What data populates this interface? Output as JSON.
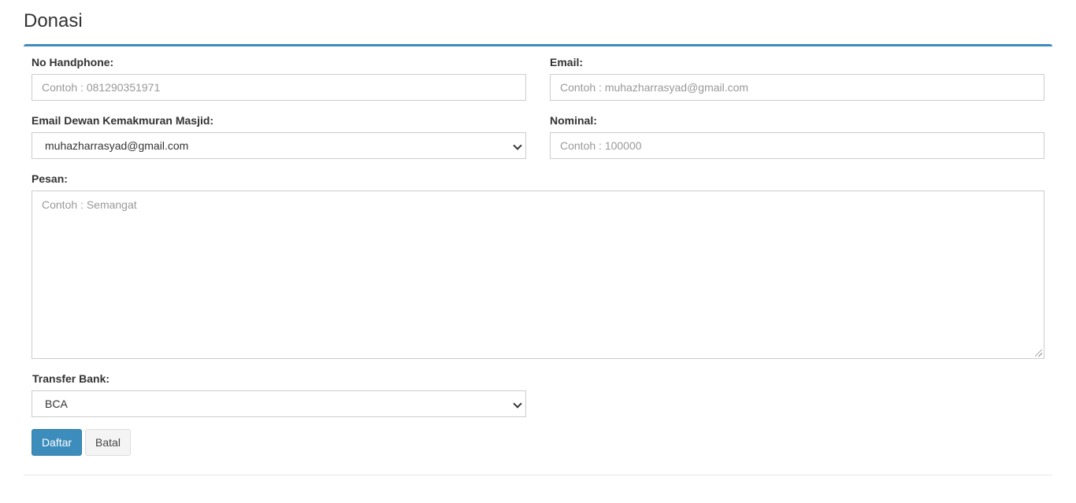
{
  "page": {
    "title": "Donasi"
  },
  "form": {
    "phone": {
      "label": "No Handphone:",
      "placeholder": "Contoh : 081290351971"
    },
    "email": {
      "label": "Email:",
      "placeholder": "Contoh : muhazharrasyad@gmail.com"
    },
    "dkm_email": {
      "label": "Email Dewan Kemakmuran Masjid:",
      "value": "muhazharrasyad@gmail.com"
    },
    "nominal": {
      "label": "Nominal:",
      "placeholder": "Contoh : 100000"
    },
    "message": {
      "label": "Pesan:",
      "placeholder": "Contoh : Semangat"
    },
    "bank": {
      "label": "Transfer Bank:",
      "value": "BCA"
    }
  },
  "actions": {
    "submit_label": "Daftar",
    "cancel_label": "Batal"
  },
  "colors": {
    "accent": "#3c8dbc",
    "border": "#cccccc"
  }
}
